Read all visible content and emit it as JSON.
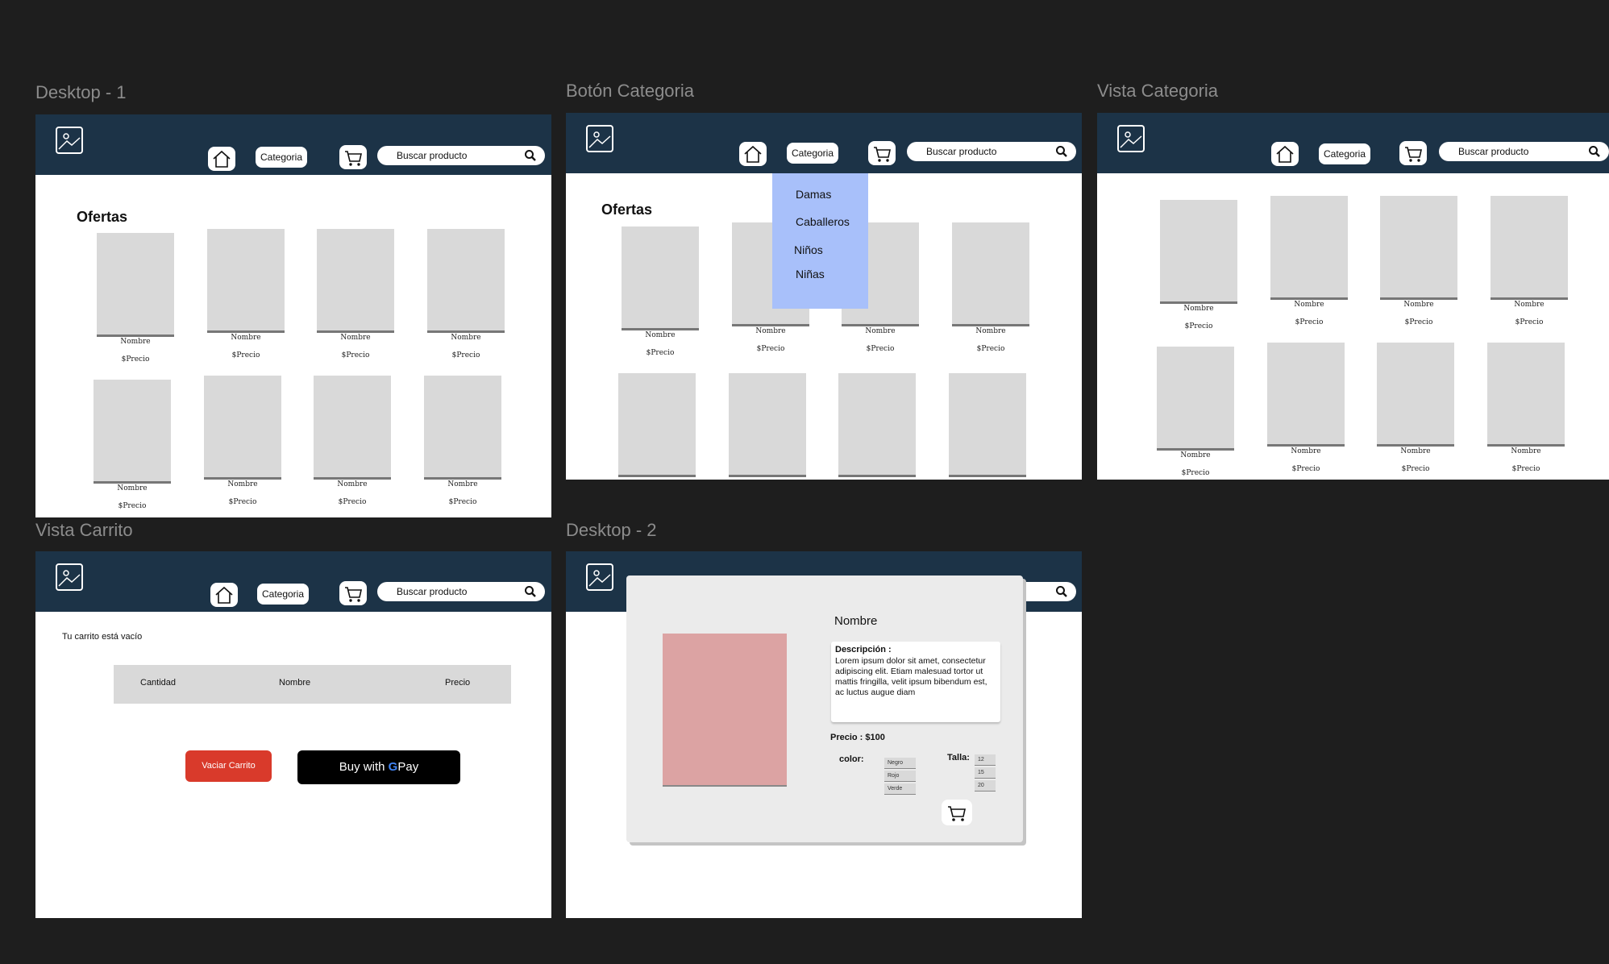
{
  "header": {
    "category_label": "Categoria",
    "search_placeholder": "Buscar producto"
  },
  "products": {
    "name": "Nombre",
    "price": "$Precio"
  },
  "frames": {
    "desktop1": {
      "title": "Desktop - 1",
      "section_title": "Ofertas"
    },
    "boton_categoria": {
      "title": "Botón Categoria",
      "section_title": "Ofertas",
      "dropdown": [
        "Damas",
        "Caballeros",
        "Niños",
        "Niñas"
      ]
    },
    "vista_categoria": {
      "title": "Vista Categoria"
    },
    "vista_carrito": {
      "title": "Vista Carrito",
      "empty_message": "Tu carrito está vacío",
      "columns": [
        "Cantidad",
        "Nombre",
        "Precio"
      ],
      "empty_button": "Vaciar Carrito",
      "gpay_prefix": "Buy with",
      "gpay_g": "G",
      "gpay_suffix": "Pay"
    },
    "desktop2": {
      "title": "Desktop - 2",
      "product_name": "Nombre",
      "description_title": "Descripción :",
      "description_text": "Lorem ipsum dolor sit amet, consectetur adipiscing elit. Etiam malesuad tortor ut mattis fringilla, velit ipsum bibendum est, ac luctus augue diam",
      "price": "Precio : $100",
      "color_label": "color:",
      "colors": [
        "Negro",
        "Rojo",
        "Verde"
      ],
      "size_label": "Talla:",
      "sizes": [
        "12",
        "15",
        "20"
      ]
    }
  },
  "colors": {
    "nav": "#1c3347",
    "dropdown": "#a8c0fa",
    "vaciar_button": "#d93a2b",
    "product_image": "#dca3a3"
  },
  "icons": [
    "image-icon",
    "home-icon",
    "cart-icon",
    "search-icon",
    "google-g-icon"
  ]
}
